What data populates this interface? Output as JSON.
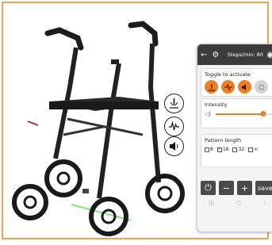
{
  "phone": {
    "status_bar": {
      "back_icon": "arrow-left",
      "settings_icon": "gear",
      "steps_text": "Steps/min: 80",
      "eye_icon": "eye"
    },
    "toggle_card": {
      "title": "Toggle to activate",
      "toggles": [
        {
          "icon": "ground-vibration",
          "active": true
        },
        {
          "icon": "waveform",
          "active": true
        },
        {
          "icon": "speaker",
          "active": true
        },
        {
          "icon": "other",
          "active": false
        }
      ]
    },
    "intensity_card": {
      "title": "Intensity",
      "speaker_icon": "speaker-small",
      "level": 0.85
    },
    "pattern_card": {
      "title": "Pattern length",
      "options": [
        {
          "label": "8",
          "checked": false
        },
        {
          "label": "16",
          "checked": true
        },
        {
          "label": "32",
          "checked": false
        },
        {
          "label": "∞",
          "checked": false
        }
      ]
    },
    "buttons": {
      "power": "⏻",
      "minus": "−",
      "plus": "+",
      "save": "save"
    },
    "nav": [
      "|||",
      "○",
      "‹"
    ]
  },
  "side_icons": [
    "ground-vibration",
    "waveform",
    "speaker"
  ],
  "colors": {
    "accent": "#f07d20",
    "frame_border": "#f2a24a",
    "laser": "#5fe05f",
    "button": "#4a4a4a"
  }
}
